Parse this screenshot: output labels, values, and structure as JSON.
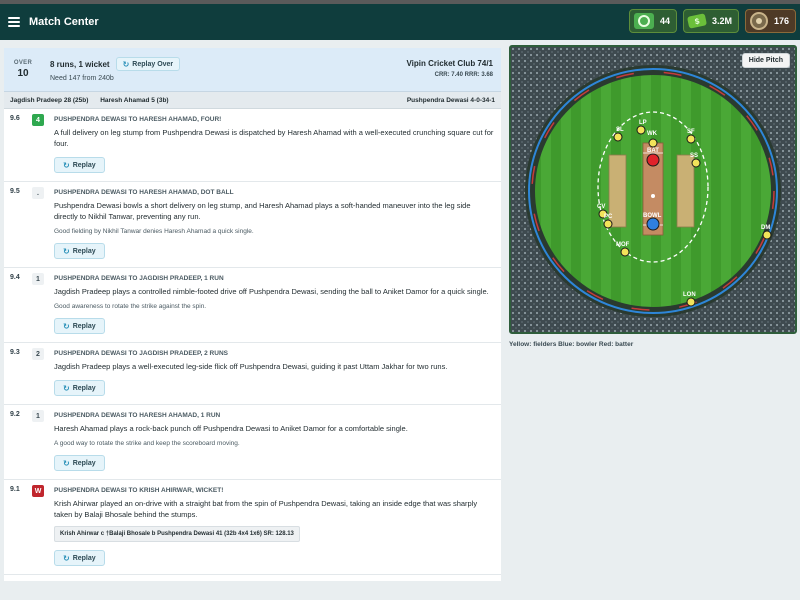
{
  "app": {
    "title": "Match Center"
  },
  "stats": [
    {
      "icon": "gems-icon",
      "value": "44"
    },
    {
      "icon": "cash-icon",
      "value": "3.2M"
    },
    {
      "icon": "badge-icon",
      "value": "176"
    }
  ],
  "over": {
    "label": "OVER",
    "number": "10",
    "summary": "8 runs, 1 wicket",
    "replay_over_label": "Replay Over",
    "need": "Need 147 from 240b",
    "team_score": "Vipin Cricket Club 74/1",
    "rates": "CRR: 7.40  RRR: 3.68"
  },
  "batters_row": {
    "batter1": "Jagdish Pradeep 28 (25b)",
    "batter2": "Haresh Ahamad 5 (3b)",
    "bowler": "Pushpendra Dewasi 4-0-34-1"
  },
  "balls": [
    {
      "num": "9.6",
      "badge": "4",
      "badge_type": "four",
      "head": "PUSHPENDRA DEWASI TO HARESH AHAMAD, FOUR!",
      "text": "A full delivery on leg stump from Pushpendra Dewasi is dispatched by Haresh Ahamad with a well-executed crunching square cut for four.",
      "note": "",
      "dismissal": "",
      "replay": "Replay"
    },
    {
      "num": "9.5",
      "badge": ".",
      "badge_type": "plain",
      "head": "PUSHPENDRA DEWASI TO HARESH AHAMAD, DOT BALL",
      "text": "Pushpendra Dewasi bowls a short delivery on leg stump, and Haresh Ahamad plays a soft-handed maneuver into the leg side directly to Nikhil Tanwar, preventing any run.",
      "note": "Good fielding by Nikhil Tanwar denies Haresh Ahamad a quick single.",
      "dismissal": "",
      "replay": "Replay"
    },
    {
      "num": "9.4",
      "badge": "1",
      "badge_type": "plain",
      "head": "PUSHPENDRA DEWASI TO JAGDISH PRADEEP, 1 RUN",
      "text": "Jagdish Pradeep plays a controlled nimble-footed drive off Pushpendra Dewasi, sending the ball to Aniket Damor for a quick single.",
      "note": "Good awareness to rotate the strike against the spin.",
      "dismissal": "",
      "replay": "Replay"
    },
    {
      "num": "9.3",
      "badge": "2",
      "badge_type": "plain",
      "head": "PUSHPENDRA DEWASI TO JAGDISH PRADEEP, 2 RUNS",
      "text": "Jagdish Pradeep plays a well-executed leg-side flick off Pushpendra Dewasi, guiding it past Uttam Jakhar for two runs.",
      "note": "",
      "dismissal": "",
      "replay": "Replay"
    },
    {
      "num": "9.2",
      "badge": "1",
      "badge_type": "plain",
      "head": "PUSHPENDRA DEWASI TO HARESH AHAMAD, 1 RUN",
      "text": "Haresh Ahamad plays a rock-back punch off Pushpendra Dewasi to Aniket Damor for a comfortable single.",
      "note": "A good way to rotate the strike and keep the scoreboard moving.",
      "dismissal": "",
      "replay": "Replay"
    },
    {
      "num": "9.1",
      "badge": "W",
      "badge_type": "wicket",
      "head": "PUSHPENDRA DEWASI TO KRISH AHIRWAR, WICKET!",
      "text": "Krish Ahirwar played an on-drive with a straight bat from the spin of Pushpendra Dewasi, taking an inside edge that was sharply taken by Balaji Bhosale behind the stumps.",
      "note": "",
      "dismissal": "Krish Ahirwar c †Balaji Bhosale b Pushpendra Dewasi 41 (32b 4x4 1x6) SR: 128.13",
      "replay": "Replay"
    }
  ],
  "pitch": {
    "hide_label": "Hide Pitch",
    "legend": "Yellow: fielders   Blue: bowler   Red: batter",
    "field_color": "#3f9a2c",
    "fielder_color": "#f2e35a",
    "bowler_color": "#2f7fe0",
    "batter_color": "#e0232b",
    "fielders": [
      {
        "label": "LP"
      },
      {
        "label": "SL"
      },
      {
        "label": "WK"
      },
      {
        "label": "SF"
      },
      {
        "label": "SS"
      },
      {
        "label": "CV"
      },
      {
        "label": "PC"
      },
      {
        "label": "MOF"
      },
      {
        "label": "DM"
      },
      {
        "label": "LON"
      }
    ],
    "batter_label": "BAT",
    "bowler_label": "BOWL"
  }
}
